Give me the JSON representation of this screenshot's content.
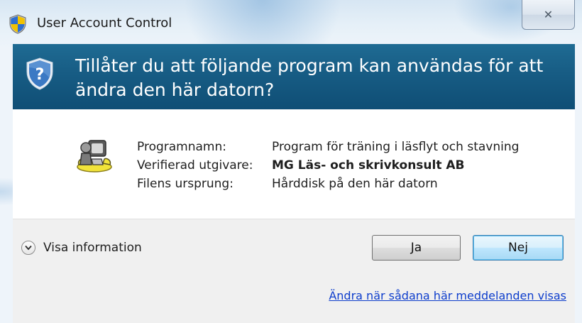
{
  "window": {
    "title": "User Account Control",
    "close_glyph": "✕",
    "title_icon": "uac-shield-icon"
  },
  "banner": {
    "question": "Tillåter du att följande program kan användas för att ändra den här datorn?",
    "icon": "question-shield-icon"
  },
  "program": {
    "icon": "program-icon",
    "rows": [
      {
        "label": "Programnamn:",
        "value": "Program för träning i läsflyt och stavning"
      },
      {
        "label": "Verifierad utgivare:",
        "value": "MG Läs- och skrivkonsult AB"
      },
      {
        "label": "Filens ursprung:",
        "value": "Hårddisk på den här datorn"
      }
    ]
  },
  "details_toggle": {
    "label": "Visa information",
    "chevron_glyph": "⌄"
  },
  "buttons": {
    "yes": "Ja",
    "no": "Nej"
  },
  "footer": {
    "link": "Ändra när sådana här meddelanden visas"
  },
  "colors": {
    "banner": "#175c84",
    "link": "#0d3dcc",
    "default_button_border": "#3c7fb1"
  }
}
